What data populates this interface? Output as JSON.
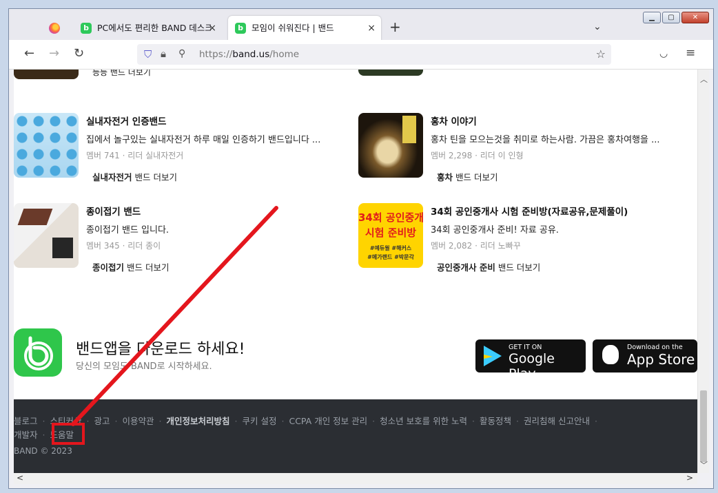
{
  "browser": {
    "tabs": [
      {
        "title": "PC에서도 편리한 BAND 데스크",
        "close": "×"
      },
      {
        "title": "모임이 쉬워진다 | 밴드",
        "close": "×"
      }
    ],
    "new_tab": "+",
    "tab_list": "⌄",
    "window_buttons": {
      "minimize": "▁",
      "maximize": "▢",
      "close": "✕"
    },
    "nav": {
      "back": "←",
      "forward": "→",
      "reload": "↻"
    },
    "url_prefix": "https://",
    "url_host": "band.us",
    "url_path": "/home"
  },
  "top_partial": {
    "left_more": "등등 밴드 더보기"
  },
  "bands": [
    {
      "name": "실내자전거 인증밴드",
      "desc": "집에서 놀구있는 실내자전거 하루 매일 인증하기 밴드입니다 ...",
      "meta": "멤버 741 · 리더 실내자전거",
      "more_bold": "실내자전거",
      "more_rest": " 밴드 더보기"
    },
    {
      "name": "홍차 이야기",
      "desc": "홍차 틴을 모으는것을 취미로 하는사람. 가끔은 홍차여행을 ...",
      "meta": "멤버 2,298 · 리더 이 인형",
      "more_bold": "홍차",
      "more_rest": " 밴드 더보기"
    },
    {
      "name": "종이접기 밴드",
      "desc": "종이접기 밴드 입니다.",
      "meta": "멤버 345 · 리더 종이",
      "more_bold": "종이접기",
      "more_rest": " 밴드 더보기"
    },
    {
      "name": "34회 공인중개사 시험 준비방(자료공유,문제풀이)",
      "desc": "34회 공인중개사 준비! 자료 공유.",
      "meta": "멤버 2,082 · 리더 노빠꾸",
      "more_bold": "공인중개사 준비",
      "more_rest": " 밴드 더보기",
      "thumb_lines": [
        "34회 공인중개사",
        "시험 준비방",
        "#예듀윌 #해커스",
        "#메가랜드 #박문각"
      ]
    }
  ],
  "download": {
    "title": "밴드앱을 다운로드 하세요!",
    "subtitle": "당신의 모임도 BAND로 시작하세요.",
    "google_small": "GET IT ON",
    "google_big": "Google Play",
    "apple_small": "Download on the",
    "apple_big": "App Store"
  },
  "footer": {
    "links": [
      "블로그",
      "스티커샵",
      "광고",
      "이용약관",
      "개인정보처리방침",
      "쿠키 설정",
      "CCPA 개인 정보 관리",
      "청소년 보호를 위한 노력",
      "활동정책",
      "권리침해 신고안내",
      "개발자",
      "도움말"
    ],
    "copyright": "BAND © 2023"
  },
  "annotation_color": "#e4161d"
}
